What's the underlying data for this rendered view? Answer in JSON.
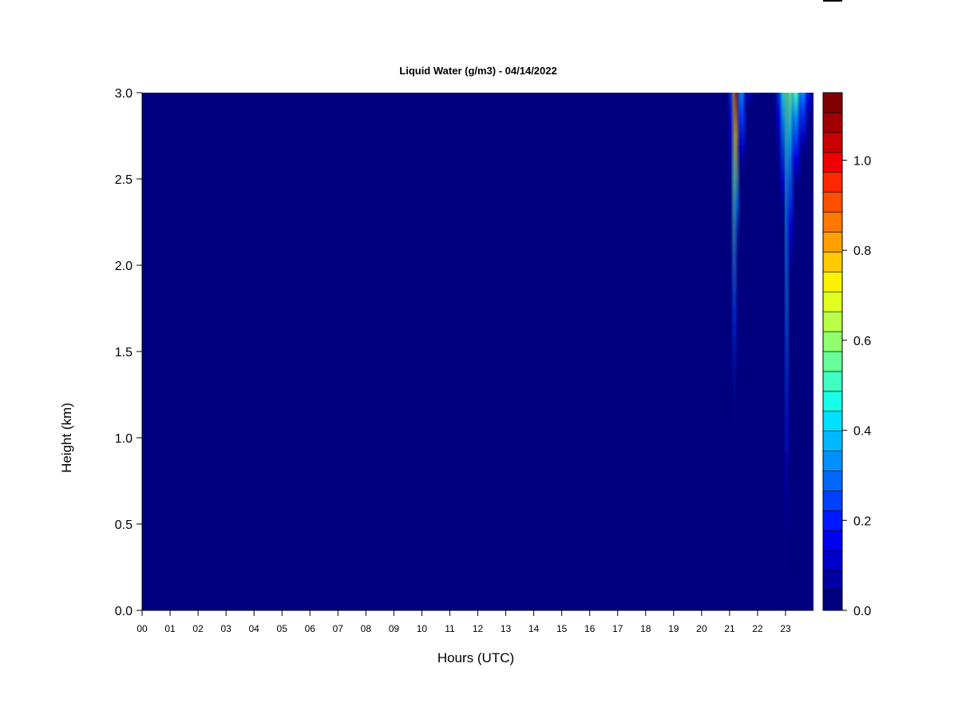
{
  "chart_data": {
    "type": "heatmap",
    "title": "Liquid Water (g/m3) - 04/14/2022",
    "xlabel": "Hours (UTC)",
    "ylabel": "Height (km)",
    "xlim": [
      0,
      24
    ],
    "ylim": [
      0,
      3.0
    ],
    "x_ticks": [
      "00",
      "01",
      "02",
      "03",
      "04",
      "05",
      "06",
      "07",
      "08",
      "09",
      "10",
      "11",
      "12",
      "13",
      "14",
      "15",
      "16",
      "17",
      "18",
      "19",
      "20",
      "21",
      "22",
      "23"
    ],
    "y_ticks": [
      "0.0",
      "0.5",
      "1.0",
      "1.5",
      "2.0",
      "2.5",
      "3.0"
    ],
    "grid": false,
    "background_value": 0.0,
    "colorbar": {
      "min": 0.0,
      "max": 1.15,
      "levels": 23,
      "tick_labels": [
        "0.0",
        "0.2",
        "0.4",
        "0.6",
        "0.8",
        "1.0"
      ],
      "colors": [
        "#00007f",
        "#0000a0",
        "#0000c8",
        "#0000f0",
        "#0018ff",
        "#0040ff",
        "#0068ff",
        "#0090ff",
        "#00b8ff",
        "#00e0ff",
        "#18ffe8",
        "#40ffc0",
        "#68ff98",
        "#90ff70",
        "#b8ff48",
        "#e0ff20",
        "#fff000",
        "#ffc800",
        "#ffa000",
        "#ff7800",
        "#ff5000",
        "#ff2800",
        "#f00000",
        "#c80000",
        "#a00000",
        "#800000"
      ]
    },
    "features": [
      {
        "x_start": 9.58,
        "x_end": 9.62,
        "y_bottom": 2.25,
        "y_top": 3.0,
        "peak": 0.05
      },
      {
        "x_start": 9.85,
        "x_end": 9.92,
        "y_bottom": 2.7,
        "y_top": 3.0,
        "peak": 0.04
      },
      {
        "x_start": 21.0,
        "x_end": 21.12,
        "y_bottom": 2.3,
        "y_top": 3.0,
        "peak": 0.25
      },
      {
        "x_start": 21.12,
        "x_end": 21.22,
        "y_bottom": 1.0,
        "y_top": 3.0,
        "peak": 0.8
      },
      {
        "x_start": 21.22,
        "x_end": 21.32,
        "y_bottom": 2.0,
        "y_top": 3.0,
        "peak": 1.1
      },
      {
        "x_start": 21.32,
        "x_end": 21.55,
        "y_bottom": 2.5,
        "y_top": 3.0,
        "peak": 0.35
      },
      {
        "x_start": 21.55,
        "x_end": 21.8,
        "y_bottom": 2.85,
        "y_top": 3.0,
        "peak": 0.12
      },
      {
        "x_start": 22.7,
        "x_end": 22.85,
        "y_bottom": 2.5,
        "y_top": 3.0,
        "peak": 0.25
      },
      {
        "x_start": 22.85,
        "x_end": 23.0,
        "y_bottom": 2.2,
        "y_top": 3.0,
        "peak": 0.45
      },
      {
        "x_start": 23.0,
        "x_end": 23.08,
        "y_bottom": 0.0,
        "y_top": 3.0,
        "peak": 0.6
      },
      {
        "x_start": 23.08,
        "x_end": 23.25,
        "y_bottom": 1.8,
        "y_top": 3.0,
        "peak": 0.55
      },
      {
        "x_start": 23.25,
        "x_end": 23.5,
        "y_bottom": 2.4,
        "y_top": 3.0,
        "peak": 0.5
      },
      {
        "x_start": 23.5,
        "x_end": 23.75,
        "y_bottom": 2.6,
        "y_top": 3.0,
        "peak": 0.35
      },
      {
        "x_start": 23.75,
        "x_end": 23.9,
        "y_bottom": 2.8,
        "y_top": 3.0,
        "peak": 0.2
      }
    ]
  }
}
